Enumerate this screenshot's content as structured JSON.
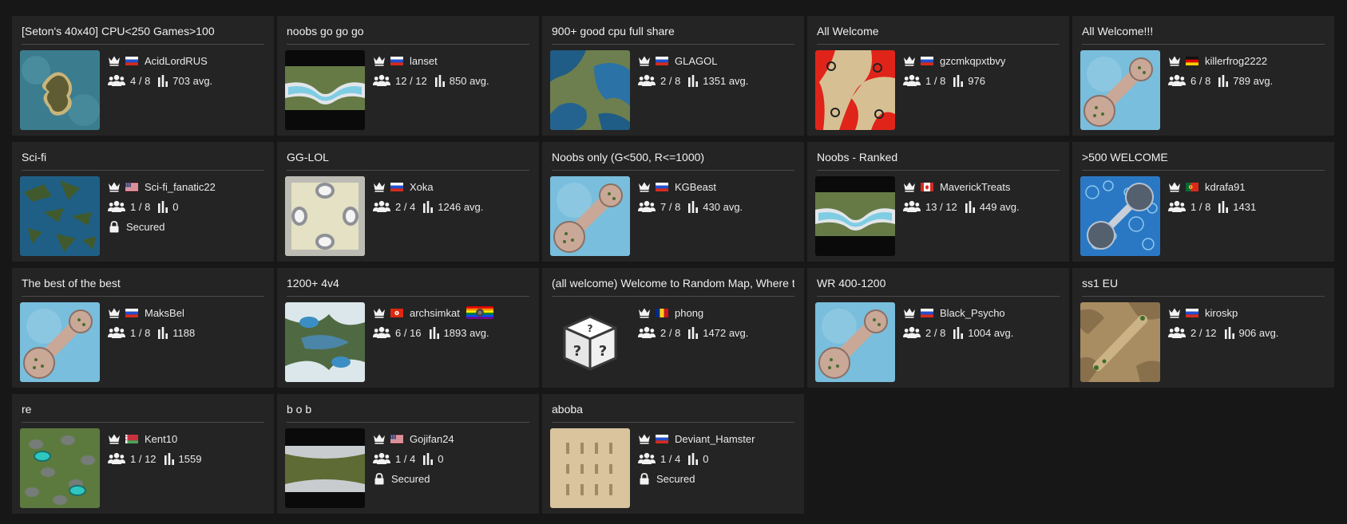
{
  "lobbies": [
    {
      "title": "[Seton's 40x40] CPU<250 Games>100",
      "host": "AcidLordRUS",
      "flag": "ru",
      "players": "4 / 8",
      "rating": "703 avg.",
      "map": "island"
    },
    {
      "title": "noobs go go go",
      "host": "lanset",
      "flag": "ru",
      "players": "12 / 12",
      "rating": "850 avg.",
      "map": "river"
    },
    {
      "title": "900+ good cpu full share",
      "host": "GLAGOL",
      "flag": "ru",
      "players": "2 / 8",
      "rating": "1351 avg.",
      "map": "lakes"
    },
    {
      "title": "All Welcome",
      "host": "gzcmkqpxtbvy",
      "flag": "ru",
      "players": "1 / 8",
      "rating": "976",
      "map": "redsand"
    },
    {
      "title": "All Welcome!!!",
      "host": "killerfrog2222",
      "flag": "de",
      "players": "6 / 8",
      "rating": "789 avg.",
      "map": "bridge"
    },
    {
      "title": "Sci-fi",
      "host": "Sci-fi_fanatic22",
      "flag": "us",
      "players": "1 / 8",
      "rating": "0",
      "secured": "Secured",
      "map": "archipelago"
    },
    {
      "title": "GG-LOL",
      "host": "Xoka",
      "flag": "ru",
      "players": "2 / 4",
      "rating": "1246 avg.",
      "map": "snow"
    },
    {
      "title": "Noobs only (G<500, R<=1000)",
      "host": "KGBeast",
      "flag": "ru",
      "players": "7 / 8",
      "rating": "430 avg.",
      "map": "bridge"
    },
    {
      "title": "Noobs - Ranked",
      "host": "MaverickTreats",
      "flag": "ca",
      "players": "13 / 12",
      "rating": "449 avg.",
      "map": "river"
    },
    {
      "title": ">500 WELCOME",
      "host": "kdrafa91",
      "flag": "pt",
      "players": "1 / 8",
      "rating": "1431",
      "map": "bubbles"
    },
    {
      "title": "The best of the best",
      "host": "MaksBel",
      "flag": "ru",
      "players": "1 / 8",
      "rating": "1188",
      "map": "bridge"
    },
    {
      "title": "1200+ 4v4",
      "host": "archsimkat",
      "flag": "hk",
      "players": "6 / 16",
      "rating": "1893 avg.",
      "map": "frozen",
      "pride": true
    },
    {
      "title": "(all welcome) Welcome to Random Map, Where the",
      "host": "phong",
      "flag": "ro",
      "players": "2 / 8",
      "rating": "1472 avg.",
      "map": "dice"
    },
    {
      "title": "WR 400-1200",
      "host": "Black_Psycho",
      "flag": "ru",
      "players": "2 / 8",
      "rating": "1004 avg.",
      "map": "bridge"
    },
    {
      "title": "ss1 EU",
      "host": "kiroskp",
      "flag": "ru",
      "players": "2 / 12",
      "rating": "906 avg.",
      "map": "desert"
    },
    {
      "title": "re",
      "host": "Kent10",
      "flag": "by",
      "players": "1 / 12",
      "rating": "1559",
      "map": "swamp"
    },
    {
      "title": "b o b",
      "host": "Gojifan24",
      "flag": "us",
      "players": "1 / 4",
      "rating": "0",
      "secured": "Secured",
      "map": "valley"
    },
    {
      "title": "aboba",
      "host": "Deviant_Hamster",
      "flag": "ru",
      "players": "1 / 4",
      "rating": "0",
      "secured": "Secured",
      "map": "parchment"
    }
  ],
  "colors": {
    "background": "#171717",
    "card": "#242424",
    "separator": "#4a4a4a",
    "text": "#e8e8e8"
  }
}
